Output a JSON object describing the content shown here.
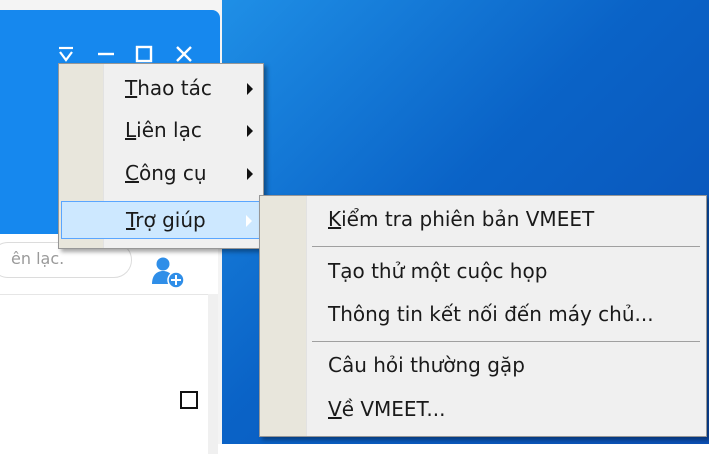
{
  "app": {
    "search_placeholder": "ên lạc.",
    "window_buttons": [
      "dropdown-icon",
      "minimize-icon",
      "maximize-icon",
      "close-icon"
    ]
  },
  "menu": {
    "items": [
      {
        "accel": "T",
        "rest": "hao tác",
        "has_submenu": true
      },
      {
        "accel": "L",
        "rest": "iên lạc",
        "has_submenu": true
      },
      {
        "accel": "C",
        "rest": "ông cụ",
        "has_submenu": true
      },
      {
        "accel": "T",
        "rest": "rợ giúp",
        "has_submenu": true,
        "highlighted": true
      }
    ]
  },
  "submenu": {
    "items": [
      {
        "accel": "K",
        "rest": "iểm tra phiên bản VMEET"
      },
      {
        "label": "Tạo thử một cuộc họp"
      },
      {
        "label": "Thông tin kết nối đến máy chủ..."
      },
      {
        "label": "Câu hỏi thường gặp"
      },
      {
        "accel": "V",
        "rest": "ề VMEET..."
      }
    ]
  },
  "colors": {
    "titlebar": "#1688ee",
    "desktop": "#0a63c7",
    "menu_bg": "#f0f0f0",
    "highlight": "#cde8ff",
    "add_contact_icon": "#2f8ee8"
  }
}
